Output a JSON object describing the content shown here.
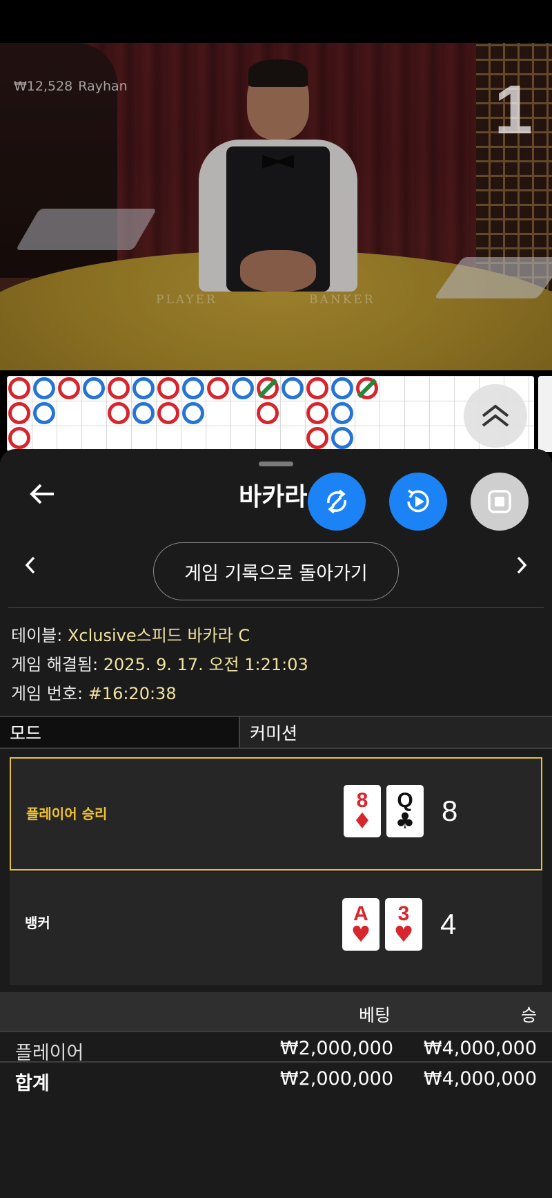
{
  "video": {
    "balance": "₩12,528",
    "dealer_name": "Rayhan",
    "round_number": "1",
    "felt_player": "PLAYER",
    "felt_banker": "BANKER"
  },
  "roadmap": {
    "colors": {
      "player": "#2574d6",
      "banker": "#d6262d",
      "tie": "#1f8a3a"
    },
    "expand_icon": "double-chevron-up-icon"
  },
  "header": {
    "title": "바카라",
    "back_icon": "arrow-left-icon",
    "sync_icon": "sync-icon",
    "replay_icon": "replay-icon",
    "stop_icon": "stop-icon"
  },
  "history_nav": {
    "label": "게임 기록으로 돌아가기",
    "prev_icon": "chevron-left-icon",
    "next_icon": "chevron-right-icon"
  },
  "info": {
    "table_label": "테이블:",
    "table_value": "Xclusive스피드 바카라 C",
    "resolved_label": "게임 해결됨:",
    "resolved_value": "2025. 9. 17. 오전 1:21:03",
    "number_label": "게임 번호:",
    "number_value": "#16:20:38"
  },
  "mode": {
    "label": "모드",
    "value": "커미션"
  },
  "results": {
    "player": {
      "label": "플레이어 승리",
      "cards": [
        {
          "rank": "8",
          "suit": "♦",
          "color": "red"
        },
        {
          "rank": "Q",
          "suit": "♣",
          "color": "black"
        }
      ],
      "score": "8"
    },
    "banker": {
      "label": "뱅커",
      "cards": [
        {
          "rank": "A",
          "suit": "♥",
          "color": "red"
        },
        {
          "rank": "3",
          "suit": "♥",
          "color": "red"
        }
      ],
      "score": "4"
    },
    "winner_accent": "#e7c23c"
  },
  "bets": {
    "headers": {
      "bet": "베팅",
      "win": "승"
    },
    "rows": [
      {
        "label": "플레이어",
        "bet": "₩2,000,000",
        "win": "₩4,000,000"
      },
      {
        "label": "합계",
        "bet": "₩2,000,000",
        "win": "₩4,000,000"
      }
    ]
  }
}
